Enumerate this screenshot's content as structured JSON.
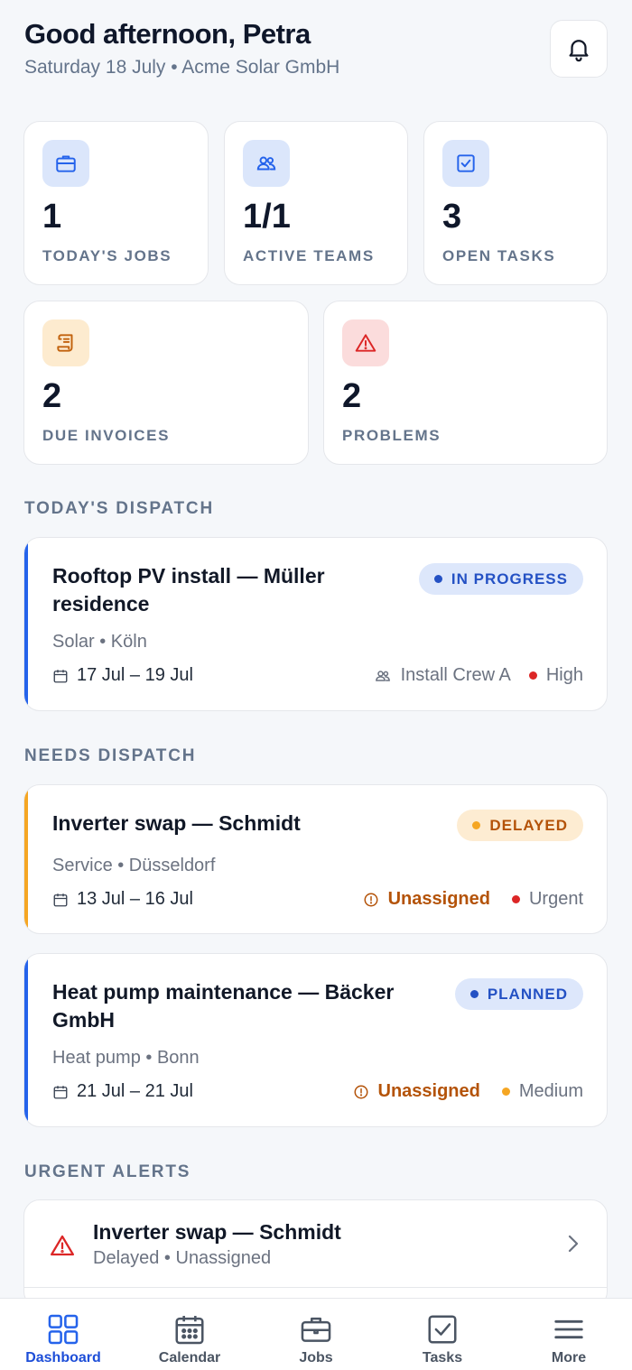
{
  "header": {
    "greeting": "Good afternoon, Petra",
    "subtitle": "Saturday 18 July • Acme Solar GmbH",
    "notifications_icon": "bell-icon"
  },
  "stats": [
    {
      "value": "1",
      "label": "TODAY'S JOBS",
      "icon": "briefcase-icon",
      "color": "#2563eb"
    },
    {
      "value": "1/1",
      "label": "ACTIVE TEAMS",
      "icon": "users-icon",
      "color": "#2563eb"
    },
    {
      "value": "3",
      "label": "OPEN TASKS",
      "icon": "checkbox-icon",
      "color": "#2563eb"
    },
    {
      "value": "2",
      "label": "DUE INVOICES",
      "icon": "receipt-icon",
      "color": "#c2620d"
    },
    {
      "value": "2",
      "label": "PROBLEMS",
      "icon": "warning-icon",
      "color": "#dc2626"
    }
  ],
  "sections": {
    "dispatch": "TODAY'S DISPATCH",
    "needs": "NEEDS DISPATCH",
    "alerts": "URGENT ALERTS"
  },
  "dispatch_jobs": [
    {
      "title_line1": "Rooftop PV install — Müller",
      "title_line2": "residence",
      "meta": "Solar • Köln",
      "dates": "17 Jul – 19 Jul",
      "status": "IN PROGRESS",
      "assignee": "Install Crew A",
      "priority": "High",
      "accent": "#2563eb"
    }
  ],
  "needs_jobs": [
    {
      "title_line1": "Inverter swap — Schmidt",
      "meta": "Service • Düsseldorf",
      "dates": "13 Jul – 16 Jul",
      "status": "DELAYED",
      "assignee": "Unassigned",
      "priority": "Urgent",
      "accent": "#f5a623"
    },
    {
      "title_line1": "Heat pump maintenance — Bäcker",
      "title_line2": "GmbH",
      "meta": "Heat pump • Bonn",
      "dates": "21 Jul – 21 Jul",
      "status": "PLANNED",
      "assignee": "Unassigned",
      "priority": "Medium",
      "accent": "#2563eb"
    }
  ],
  "alerts": [
    {
      "title": "Inverter swap — Schmidt",
      "subtitle": "Delayed • Unassigned"
    }
  ],
  "nav": [
    {
      "label": "Dashboard",
      "icon": "dashboard-grid-icon",
      "active": true
    },
    {
      "label": "Calendar",
      "icon": "calendar-icon",
      "active": false
    },
    {
      "label": "Jobs",
      "icon": "briefcase-icon",
      "active": false
    },
    {
      "label": "Tasks",
      "icon": "checkbox-icon",
      "active": false
    },
    {
      "label": "More",
      "icon": "menu-icon",
      "active": false
    }
  ]
}
